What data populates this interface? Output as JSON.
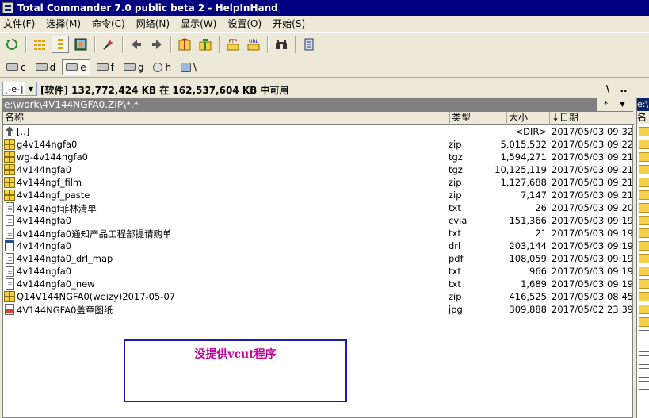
{
  "window": {
    "title": "Total Commander 7.0 public beta 2 - HelpInHand"
  },
  "menu": [
    "文件(F)",
    "选择(M)",
    "命令(C)",
    "网络(N)",
    "显示(W)",
    "设置(O)",
    "开始(S)"
  ],
  "toolbar": {
    "icons": [
      "refresh-icon",
      "brief-view-icon",
      "full-view-icon",
      "thumbnail-icon",
      "select-icon",
      "back-icon",
      "forward-icon",
      "pack-icon",
      "unpack-icon",
      "ftp-icon",
      "url-icon",
      "find-icon",
      "notepad-icon"
    ],
    "ftp_label": "FTP",
    "url_label": "URL"
  },
  "drives": [
    {
      "letter": "c",
      "type": "hdd",
      "active": false
    },
    {
      "letter": "d",
      "type": "hdd",
      "active": false
    },
    {
      "letter": "e",
      "type": "hdd",
      "active": true
    },
    {
      "letter": "f",
      "type": "hdd",
      "active": false
    },
    {
      "letter": "g",
      "type": "hdd",
      "active": false
    },
    {
      "letter": "h",
      "type": "cd",
      "active": false
    },
    {
      "letter": "\\",
      "type": "net",
      "active": false
    }
  ],
  "drive_select": {
    "value": "[-e-]"
  },
  "disk_info": "[软件]  132,772,424 KB 在 162,537,604 KB 中可用",
  "path_buttons": {
    "root": "\\",
    "up": "..",
    "filter": "*"
  },
  "current_path": "e:\\work\\4V144NGFA0.ZIP\\*.*",
  "columns": {
    "name": "名称",
    "type": "类型",
    "size": "大小",
    "date": "↓日期"
  },
  "files": [
    {
      "icon": "up",
      "name": "[..]",
      "ext": "",
      "size": "<DIR>",
      "date": "2017/05/03 09:32"
    },
    {
      "icon": "archive",
      "name": "g4v144ngfa0",
      "ext": "zip",
      "size": "5,015,532",
      "date": "2017/05/03 09:22"
    },
    {
      "icon": "archive",
      "name": "wg-4v144ngfa0",
      "ext": "tgz",
      "size": "1,594,271",
      "date": "2017/05/03 09:21"
    },
    {
      "icon": "archive",
      "name": "4v144ngfa0",
      "ext": "tgz",
      "size": "10,125,119",
      "date": "2017/05/03 09:21"
    },
    {
      "icon": "archive",
      "name": "4v144ngf_film",
      "ext": "zip",
      "size": "1,127,688",
      "date": "2017/05/03 09:21"
    },
    {
      "icon": "archive",
      "name": "4v144ngf_paste",
      "ext": "zip",
      "size": "7,147",
      "date": "2017/05/03 09:21"
    },
    {
      "icon": "doc",
      "name": "4v144ngf菲林清单",
      "ext": "txt",
      "size": "26",
      "date": "2017/05/03 09:20"
    },
    {
      "icon": "doc",
      "name": "4v144ngfa0",
      "ext": "cvia",
      "size": "151,366",
      "date": "2017/05/03 09:19"
    },
    {
      "icon": "doc",
      "name": "4v144ngfa0通知产品工程部提请购单",
      "ext": "txt",
      "size": "21",
      "date": "2017/05/03 09:19"
    },
    {
      "icon": "drl",
      "name": "4v144ngfa0",
      "ext": "drl",
      "size": "203,144",
      "date": "2017/05/03 09:19"
    },
    {
      "icon": "doc",
      "name": "4v144ngfa0_drl_map",
      "ext": "pdf",
      "size": "108,059",
      "date": "2017/05/03 09:19"
    },
    {
      "icon": "doc",
      "name": "4v144ngfa0",
      "ext": "txt",
      "size": "966",
      "date": "2017/05/03 09:19"
    },
    {
      "icon": "doc",
      "name": "4v144ngfa0_new",
      "ext": "txt",
      "size": "1,689",
      "date": "2017/05/03 09:19"
    },
    {
      "icon": "archive",
      "name": "Q14V144NGFA0(weizy)2017-05-07",
      "ext": "zip",
      "size": "416,525",
      "date": "2017/05/03 08:45"
    },
    {
      "icon": "img",
      "name": "4V144NGFA0盖章图纸",
      "ext": "jpg",
      "size": "309,888",
      "date": "2017/05/02 23:39"
    }
  ],
  "annotation": {
    "text": "没提供vcut程序",
    "color": "#c8009b",
    "border_color": "#1c1ca8"
  },
  "right_panel": {
    "path": "e:\\",
    "header": "名称"
  },
  "colors": {
    "titlebar": "#000080",
    "path_bg": "#808080",
    "face": "#ece9d8"
  }
}
